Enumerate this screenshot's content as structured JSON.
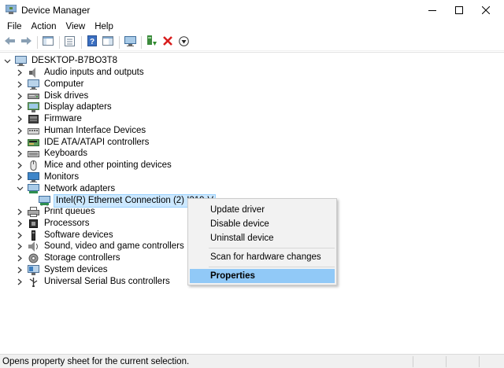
{
  "window": {
    "title": "Device Manager",
    "minimize_icon": "minimize-icon",
    "maximize_icon": "maximize-icon",
    "close_icon": "close-icon"
  },
  "menu": {
    "items": [
      "File",
      "Action",
      "View",
      "Help"
    ]
  },
  "toolbar": {
    "buttons": [
      "back-arrow-icon",
      "forward-arrow-icon",
      "show-hide-tree-icon",
      "properties-icon",
      "help-icon",
      "action-pane-icon",
      "scan-hardware-icon",
      "update-driver-icon",
      "uninstall-icon",
      "disable-icon"
    ]
  },
  "tree": {
    "root": "DESKTOP-B7BO3T8",
    "categories": [
      "Audio inputs and outputs",
      "Computer",
      "Disk drives",
      "Display adapters",
      "Firmware",
      "Human Interface Devices",
      "IDE ATA/ATAPI controllers",
      "Keyboards",
      "Mice and other pointing devices",
      "Monitors",
      "Network adapters",
      "Print queues",
      "Processors",
      "Software devices",
      "Sound, video and game controllers",
      "Storage controllers",
      "System devices",
      "Universal Serial Bus controllers"
    ],
    "expanded_category": "Network adapters",
    "selected_device": "Intel(R) Ethernet Connection (2) I219-V"
  },
  "context_menu": {
    "update_driver": "Update driver",
    "disable_device": "Disable device",
    "uninstall_device": "Uninstall device",
    "scan_hardware": "Scan for hardware changes",
    "properties": "Properties",
    "highlighted": "Properties"
  },
  "status": {
    "text": "Opens property sheet for the current selection."
  },
  "colors": {
    "selection_bg": "#cce8ff",
    "menu_highlight": "#91c9f7",
    "menu_bg": "#f2f2f2",
    "statusbar_bg": "#f0f0f0"
  }
}
